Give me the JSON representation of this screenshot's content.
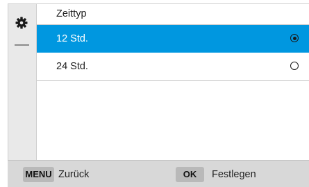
{
  "menu": {
    "title": "Zeittyp",
    "options": [
      {
        "label": "12 Std.",
        "selected": true
      },
      {
        "label": "24 Std.",
        "selected": false
      }
    ],
    "selected_color": "#0097e0"
  },
  "sidebar": {
    "icon": "gear-icon"
  },
  "footer": {
    "menu_key": "MENU",
    "back_label": "Zurück",
    "ok_key": "OK",
    "set_label": "Festlegen"
  }
}
